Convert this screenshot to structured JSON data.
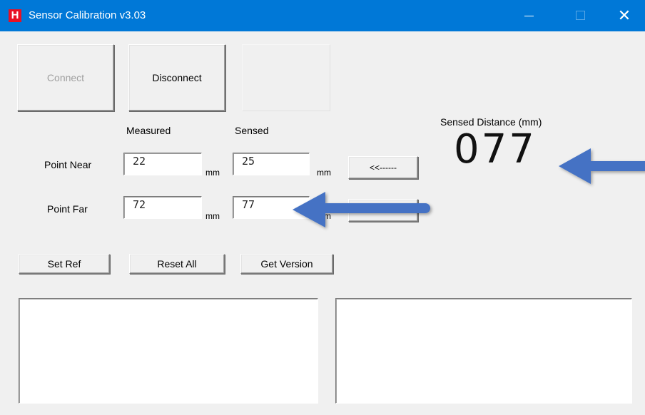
{
  "window": {
    "title": "Sensor Calibration v3.03",
    "app_icon_letter": "H",
    "minimize_glyph": "",
    "maximize_glyph": "",
    "close_glyph": "✕"
  },
  "buttons": {
    "connect": "Connect",
    "disconnect": "Disconnect",
    "near_arrow": "<<------",
    "set_ref": "Set Ref",
    "reset_all": "Reset All",
    "get_version": "Get Version"
  },
  "headers": {
    "measured": "Measured",
    "sensed": "Sensed"
  },
  "rows": {
    "near": {
      "label": "Point Near",
      "measured": "22",
      "sensed": "25",
      "unit": "mm"
    },
    "far": {
      "label": "Point Far",
      "measured": "72",
      "sensed": "77",
      "unit": "mm"
    }
  },
  "sensed_distance": {
    "label": "Sensed Distance (mm)",
    "value": "077"
  },
  "annotations": {
    "arrow_color": "#4472c4"
  },
  "colors": {
    "titlebar": "#0078d7",
    "app_icon": "#e81123"
  }
}
